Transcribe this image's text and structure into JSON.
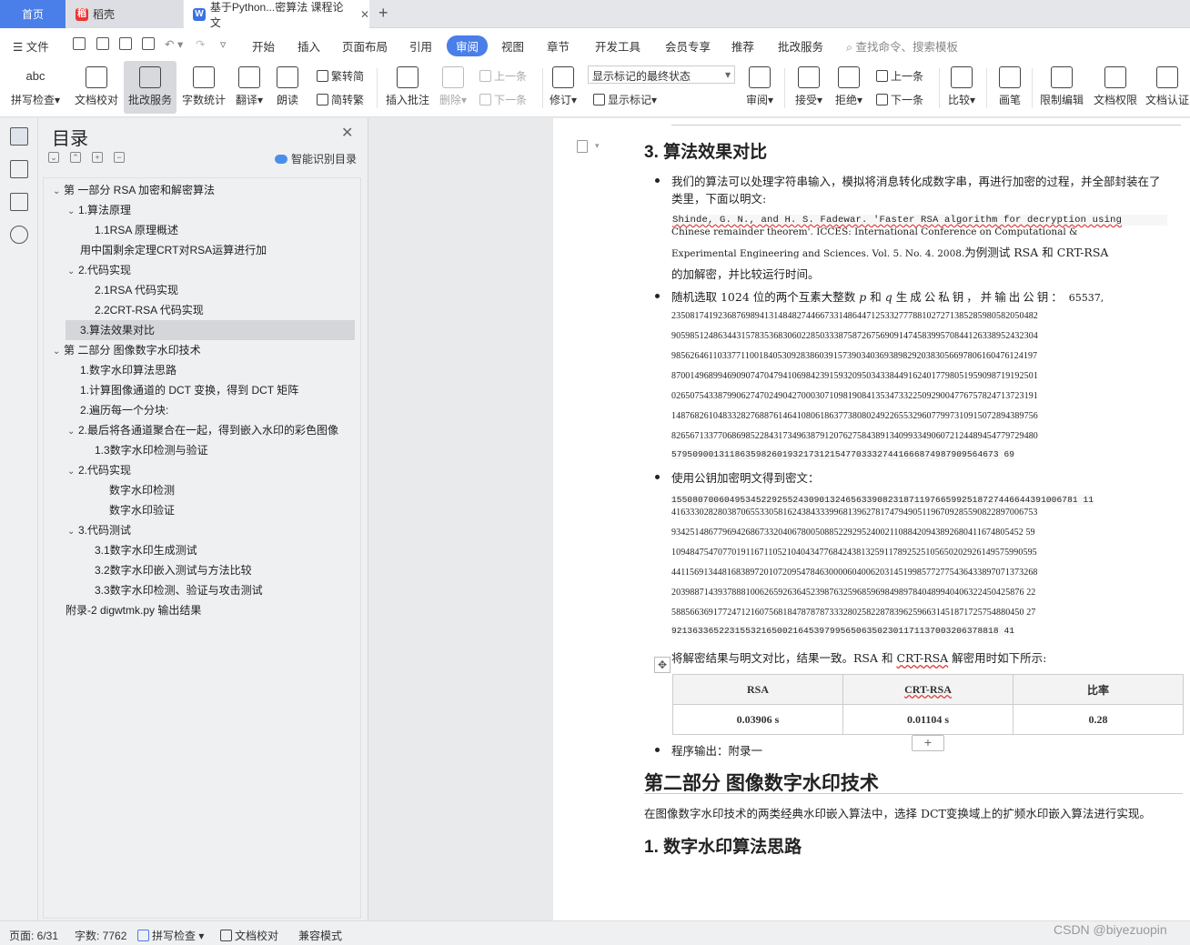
{
  "tabs": {
    "home": "首页",
    "daoke": "稻壳",
    "doc": "基于Python...密算法 课程论文"
  },
  "menu": {
    "file": "文件",
    "items": [
      "开始",
      "插入",
      "页面布局",
      "引用",
      "审阅",
      "视图",
      "章节",
      "开发工具",
      "会员专享",
      "推荐",
      "批改服务"
    ],
    "search": "查找命令、搜索模板"
  },
  "ribbon": {
    "spell": "拼写检查",
    "doccheck": "文档校对",
    "grading": "批改服务",
    "wordcount": "字数统计",
    "translate": "翻译",
    "read": "朗读",
    "trad": "繁转简",
    "simp": "简转繁",
    "insert_comment": "插入批注",
    "delete": "删除",
    "prev": "上一条",
    "next": "下一条",
    "track": "修订",
    "markup_state": "显示标记的最终状态",
    "show_markup": "显示标记",
    "review": "审阅",
    "accept": "接受",
    "reject": "拒绝",
    "prev2": "上一条",
    "next2": "下一条",
    "compare": "比较",
    "pen": "画笔",
    "restrict": "限制编辑",
    "perm": "文档权限",
    "auth": "文档认证"
  },
  "toc": {
    "title": "目录",
    "smart": "智能识别目录",
    "items": [
      "第 一部分 RSA 加密和解密算法",
      "1.算法原理",
      "1.1RSA 原理概述",
      "用中国剩余定理CRT对RSA运算进行加",
      "2.代码实现",
      "2.1RSA 代码实现",
      "2.2CRT-RSA 代码实现",
      "3.算法效果对比",
      "第 二部分 图像数字水印技术",
      "1.数字水印算法思路",
      "1.计算图像通道的 DCT 变换，得到 DCT 矩阵",
      "2.遍历每一个分块:",
      "2.最后将各通道聚合在一起，得到嵌入水印的彩色图像",
      "1.3数字水印检测与验证",
      "2.代码实现",
      "数字水印检测",
      "数字水印验证",
      "3.代码测试",
      "3.1数字水印生成测试",
      "3.2数字水印嵌入测试与方法比较",
      "3.3数字水印检测、验证与攻击测试",
      "附录-2 digwtmk.py 输出结果"
    ]
  },
  "doc": {
    "h_compare": "3. 算法效果对比",
    "p1a": "我们的算法可以处理字符串输入，模拟将消息转化成数字串，再进行加密的过程，并全部封装在了",
    "p1b": "类里，下面以明文:",
    "code1": "Shinde, G. N., and H. S. Fadewar. 'Faster RSA algorithm for decryption using",
    "code2": "Chinese remainder theorem'. ICCES: International Conference on Computational &",
    "code3a": "Experimental Engineering and Sciences. Vol. 5. No. 4. 2008.",
    "code3b": "为例测试 RSA 和 CRT-RSA",
    "p2": "的加解密，并比较运行时间。",
    "p3a": "随机选取 1024 位的两个互素大整数",
    "p3b": "p",
    "p3c": "和",
    "p3d": "q",
    "p3e": "生成公私钥，并输出公钥：",
    "p3f": "65537,",
    "pub": [
      "2350817419236876989413148482744667331486447125332777881027271385285980582050482",
      "9059851248634431578353683060228503338758726756909147458399570844126338952432304",
      "9856264611033771100184053092838603915739034036938982920383056697806160476124197",
      "8700149689946909074704794106984239159320950343384491624017798051959098719192501",
      "0265075433879906274702490427000307109819084135347332250929004776757824713723191",
      "1487682610483328276887614641080618637738080249226553296077997310915072894389756",
      "8265671337706869852284317349638791207627584389134099334906072124489454779729480",
      "57950900131186359826019321731215477033327441666874987909564673 69"
    ],
    "p4": "使用公钥加密明文得到密文：",
    "cipher": [
      "15508070060495345229255243090132465633908231871197665992518727446644391006781 11",
      "4163330282803870655330581624384333996813962781747949051196709285590822897006753",
      "9342514867796942686733204067800508852292952400211088420943892680411674805452 59",
      "1094847547077019116711052104043477684243813259117892525105650202926149575990595",
      "4411569134481683897201072095478463000060400620314519985772775436433897071373268",
      "2039887143937888100626592636452398763259685969849897840489940406322450425876 22",
      "5885663691772471216075681847878787333280258228783962596631451871725754880450 27",
      "92136336522315532165002164539799565063502301171137003206378818 41"
    ],
    "p5a": "将解密结果与明文对比，结果一致。RSA 和",
    "p5b": "CRT-RSA",
    "p5c": "解密用时如下所示:",
    "table": {
      "h": [
        "RSA",
        "CRT-RSA",
        "比率"
      ],
      "r": [
        "0.03906 s",
        "0.01104 s",
        "0.28"
      ]
    },
    "p6": "程序输出：附录一",
    "h_part2": "第二部分 图像数字水印技术",
    "p7": "在图像数字水印技术的两类经典水印嵌入算法中，选择 DCT变换域上的扩频水印嵌入算法进行实现。",
    "h_wm": "1. 数字水印算法思路"
  },
  "status": {
    "page": "页面: 6/31",
    "words": "字数: 7762",
    "spell": "拼写检查",
    "doccheck": "文档校对",
    "compat": "兼容模式"
  },
  "watermark": "CSDN @biyezuopin"
}
